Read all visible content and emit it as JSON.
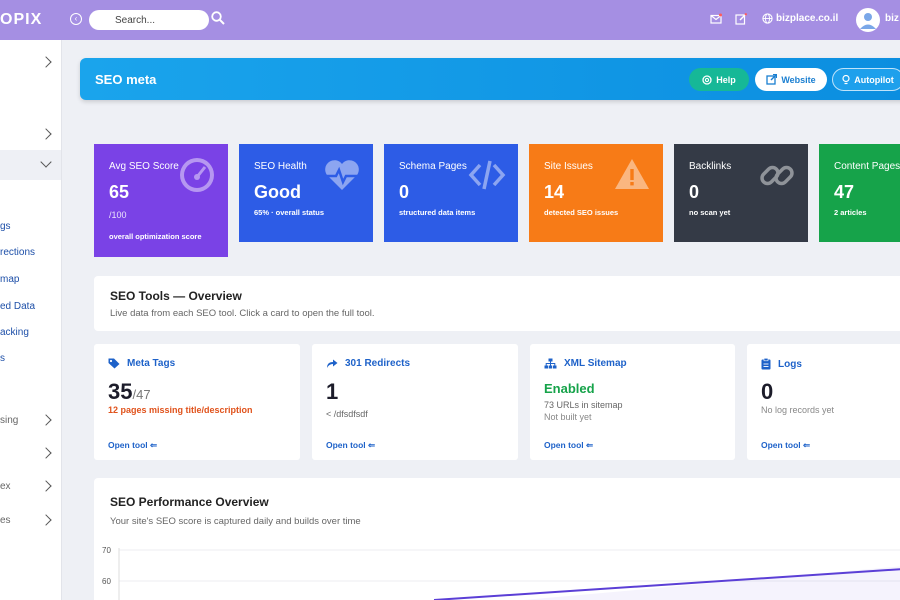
{
  "topbar": {
    "logo": "OPIX",
    "search_placeholder": "Search...",
    "site_name": "bizplace.co.il",
    "user_name": "biz"
  },
  "sidebar": {
    "labels": [
      "gs",
      "rections",
      "map",
      "ed Data",
      "acking",
      "s",
      "sing",
      "ex",
      "es"
    ]
  },
  "header": {
    "title": "SEO meta",
    "buttons": {
      "help": "Help",
      "website": "Website",
      "autopilot": "Autopilot"
    }
  },
  "stats": [
    {
      "title": "Avg SEO Score",
      "value": "65",
      "sub2": "/100",
      "sub": "overall optimization score",
      "color": "#7a42e6",
      "icon": "gauge-icon"
    },
    {
      "title": "SEO Health",
      "value": "Good",
      "sub": "65% · overall status",
      "color": "#2d5ce6",
      "icon": "heartbeat-icon"
    },
    {
      "title": "Schema Pages",
      "value": "0",
      "sub": "structured data items",
      "color": "#2d5ce6",
      "icon": "code-icon"
    },
    {
      "title": "Site Issues",
      "value": "14",
      "sub": "detected SEO issues",
      "color": "#f77b17",
      "icon": "warning-icon"
    },
    {
      "title": "Backlinks",
      "value": "0",
      "sub": "no scan yet",
      "color": "#343a46",
      "icon": "link-icon"
    },
    {
      "title": "Content Pages",
      "value": "47",
      "sub": "2 articles",
      "color": "#16a34a",
      "icon": "file-icon"
    }
  ],
  "tools_overview": {
    "title": "SEO Tools — Overview",
    "subtitle": "Live data from each SEO tool. Click a card to open the full tool."
  },
  "tools": [
    {
      "name": "Meta Tags",
      "icon": "tag-icon",
      "value": "35",
      "value_suffix": "/47",
      "line1": "12 pages missing title/description",
      "line1_color": "#e0521b",
      "line2": "",
      "open": "Open tool ⇐"
    },
    {
      "name": "301 Redirects",
      "icon": "redirect-icon",
      "value": "1",
      "value_suffix": "",
      "line1": "< /dfsdfsdf",
      "line1_color": "#666",
      "line2": "",
      "open": "Open tool ⇐"
    },
    {
      "name": "XML Sitemap",
      "icon": "sitemap-icon",
      "value": "Enabled",
      "value_suffix": "",
      "line1": "73 URLs in sitemap",
      "line1_color": "#666",
      "line2": "Not built yet",
      "open": "Open tool ⇐"
    },
    {
      "name": "Logs",
      "icon": "clipboard-icon",
      "value": "0",
      "value_suffix": "",
      "line1": "No log records yet",
      "line1_color": "#888",
      "line2": "",
      "open": "Open tool ⇐"
    }
  ],
  "performance": {
    "title": "SEO Performance Overview",
    "subtitle": "Your site's SEO score is captured daily and builds over time",
    "y_ticks": [
      "70",
      "60"
    ]
  }
}
